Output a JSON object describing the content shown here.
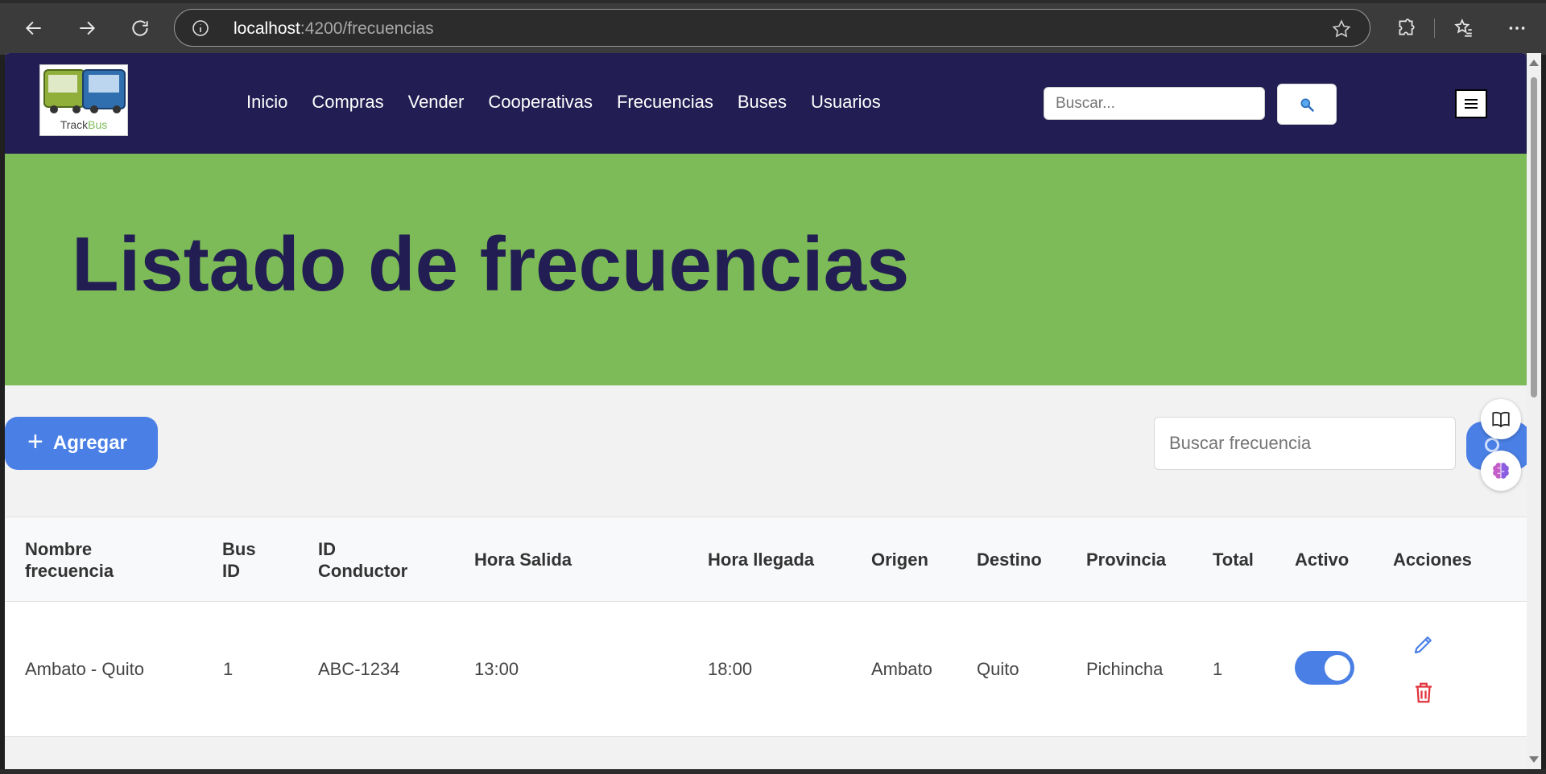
{
  "browser": {
    "url_host": "localhost",
    "url_rest": ":4200/frecuencias"
  },
  "navbar": {
    "logo_text_a": "Track",
    "logo_text_b": "Bus",
    "links": [
      "Inicio",
      "Compras",
      "Vender",
      "Cooperativas",
      "Frecuencias",
      "Buses",
      "Usuarios"
    ],
    "search_placeholder": "Buscar..."
  },
  "hero": {
    "title": "Listado de frecuencias"
  },
  "toolbar": {
    "add_label": "Agregar",
    "filter_placeholder": "Buscar frecuencia"
  },
  "table": {
    "headers": {
      "nombre_a": "Nombre",
      "nombre_b": "frecuencia",
      "bus_a": "Bus",
      "bus_b": "ID",
      "cond_a": "ID",
      "cond_b": "Conductor",
      "salida": "Hora Salida",
      "llegada": "Hora llegada",
      "origen": "Origen",
      "destino": "Destino",
      "provincia": "Provincia",
      "total": "Total",
      "activo": "Activo",
      "acciones": "Acciones"
    },
    "rows": [
      {
        "nombre": "Ambato - Quito",
        "bus_id": "1",
        "conductor": "ABC-1234",
        "salida": "13:00",
        "llegada": "18:00",
        "origen": "Ambato",
        "destino": "Quito",
        "provincia": "Pichincha",
        "total": "1",
        "activo": true
      }
    ]
  },
  "colors": {
    "navbar": "#221d52",
    "hero": "#7cbb57",
    "accent": "#4a7fe5",
    "danger": "#e0333c"
  }
}
